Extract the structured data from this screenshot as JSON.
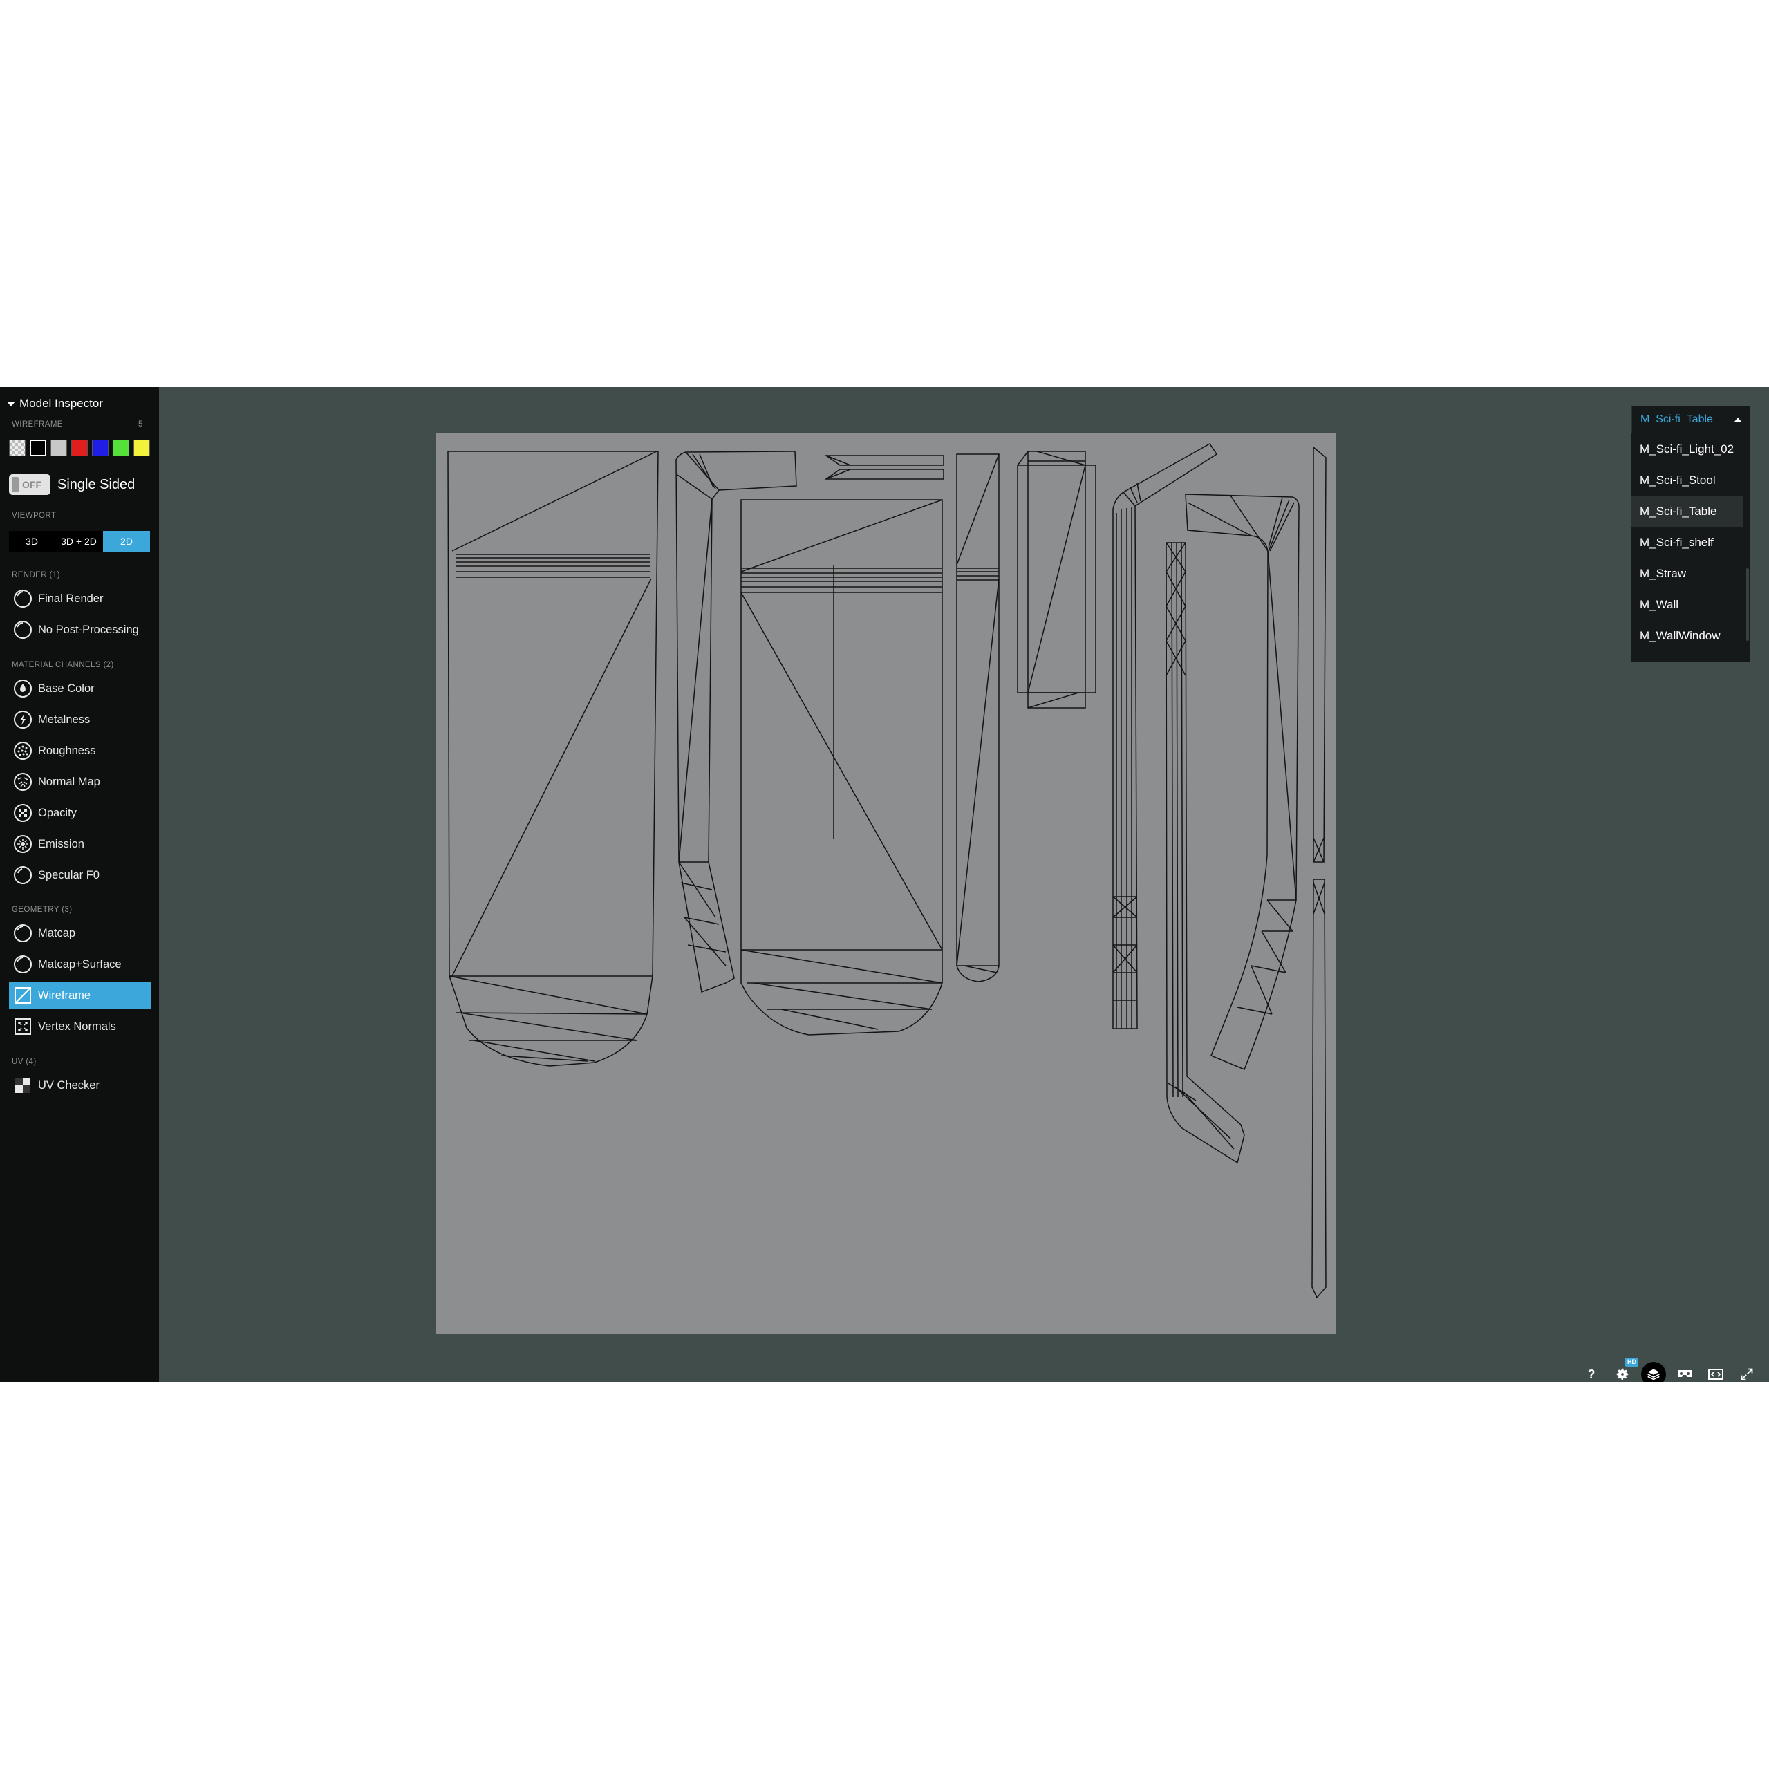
{
  "sidebar": {
    "header": "Model Inspector",
    "wireframe_label": "WIREFRAME",
    "wireframe_count": "5",
    "swatch_colors": [
      "checker",
      "#000000",
      "#c8c8c8",
      "#e01e1e",
      "#1e1ee6",
      "#55e03a",
      "#f2f23a"
    ],
    "single_sided": {
      "toggle": "OFF",
      "label": "Single Sided"
    },
    "viewport": {
      "label": "VIEWPORT",
      "options": [
        "3D",
        "3D + 2D",
        "2D"
      ],
      "selected": "2D"
    },
    "render": {
      "label": "RENDER (1)",
      "items": [
        "Final Render",
        "No Post-Processing"
      ]
    },
    "material_channels": {
      "label": "MATERIAL CHANNELS (2)",
      "items": [
        "Base Color",
        "Metalness",
        "Roughness",
        "Normal Map",
        "Opacity",
        "Emission",
        "Specular F0"
      ]
    },
    "geometry": {
      "label": "GEOMETRY (3)",
      "items": [
        "Matcap",
        "Matcap+Surface",
        "Wireframe",
        "Vertex Normals"
      ],
      "selected": "Wireframe"
    },
    "uv": {
      "label": "UV (4)",
      "items": [
        "UV Checker"
      ]
    }
  },
  "material_select": {
    "selected": "M_Sci-fi_Table",
    "options": [
      "M_Sci-fi_Light_02",
      "M_Sci-fi_Stool",
      "M_Sci-fi_Table",
      "M_Sci-fi_shelf",
      "M_Straw",
      "M_Wall",
      "M_WallWindow"
    ]
  },
  "toolbar": {
    "help_icon": "?",
    "hd_badge": "HD",
    "icons": [
      "help-icon",
      "settings-icon",
      "layers-icon",
      "vr-icon",
      "embed-icon",
      "fullscreen-icon"
    ]
  },
  "colors": {
    "accent": "#3ba7db",
    "sidebar_bg": "#0e1010",
    "viewport_bg": "#414d4b",
    "uv_canvas": "#8c8e8f"
  }
}
